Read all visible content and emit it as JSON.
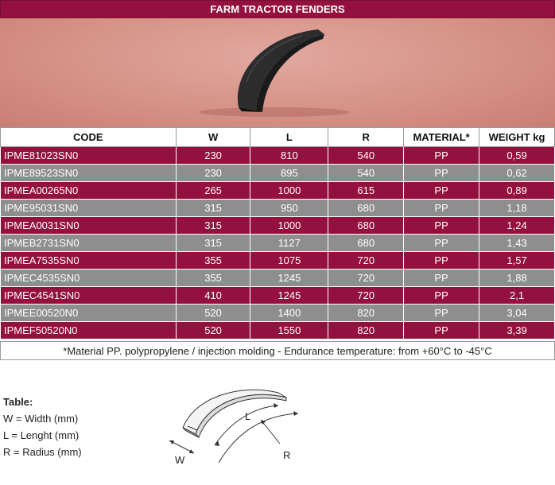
{
  "header": {
    "title": "FARM TRACTOR FENDERS"
  },
  "table": {
    "columns": [
      "CODE",
      "W",
      "L",
      "R",
      "MATERIAL*",
      "WEIGHT kg"
    ],
    "rows": [
      {
        "code": "IPME81023SN0",
        "w": "230",
        "l": "810",
        "r": "540",
        "material": "PP",
        "weight": "0,59"
      },
      {
        "code": "IPME89523SN0",
        "w": "230",
        "l": "895",
        "r": "540",
        "material": "PP",
        "weight": "0,62"
      },
      {
        "code": "IPMEA00265N0",
        "w": "265",
        "l": "1000",
        "r": "615",
        "material": "PP",
        "weight": "0,89"
      },
      {
        "code": "IPME95031SN0",
        "w": "315",
        "l": "950",
        "r": "680",
        "material": "PP",
        "weight": "1,18"
      },
      {
        "code": "IPMEA0031SN0",
        "w": "315",
        "l": "1000",
        "r": "680",
        "material": "PP",
        "weight": "1,24"
      },
      {
        "code": "IPMEB2731SN0",
        "w": "315",
        "l": "1127",
        "r": "680",
        "material": "PP",
        "weight": "1,43"
      },
      {
        "code": "IPMEA7535SN0",
        "w": "355",
        "l": "1075",
        "r": "720",
        "material": "PP",
        "weight": "1,57"
      },
      {
        "code": "IPMEC4535SN0",
        "w": "355",
        "l": "1245",
        "r": "720",
        "material": "PP",
        "weight": "1,88"
      },
      {
        "code": "IPMEC4541SN0",
        "w": "410",
        "l": "1245",
        "r": "720",
        "material": "PP",
        "weight": "2,1"
      },
      {
        "code": "IPMEE00520N0",
        "w": "520",
        "l": "1400",
        "r": "820",
        "material": "PP",
        "weight": "3,04"
      },
      {
        "code": "IPMEF50520N0",
        "w": "520",
        "l": "1550",
        "r": "820",
        "material": "PP",
        "weight": "3,39"
      }
    ]
  },
  "footnote": "*Material PP. polypropylene / injection molding  -  Endurance temperature: from +60°C to -45°C",
  "legend": {
    "title": "Table:",
    "lines": [
      "W = Width (mm)",
      "L = Lenght (mm)",
      "R = Radius (mm)"
    ]
  },
  "diagram": {
    "label_w": "W",
    "label_l": "L",
    "label_r": "R"
  },
  "colors": {
    "accent": "#94113f",
    "alt_row": "#8e8e8e",
    "photo_bg": "#d69286"
  }
}
